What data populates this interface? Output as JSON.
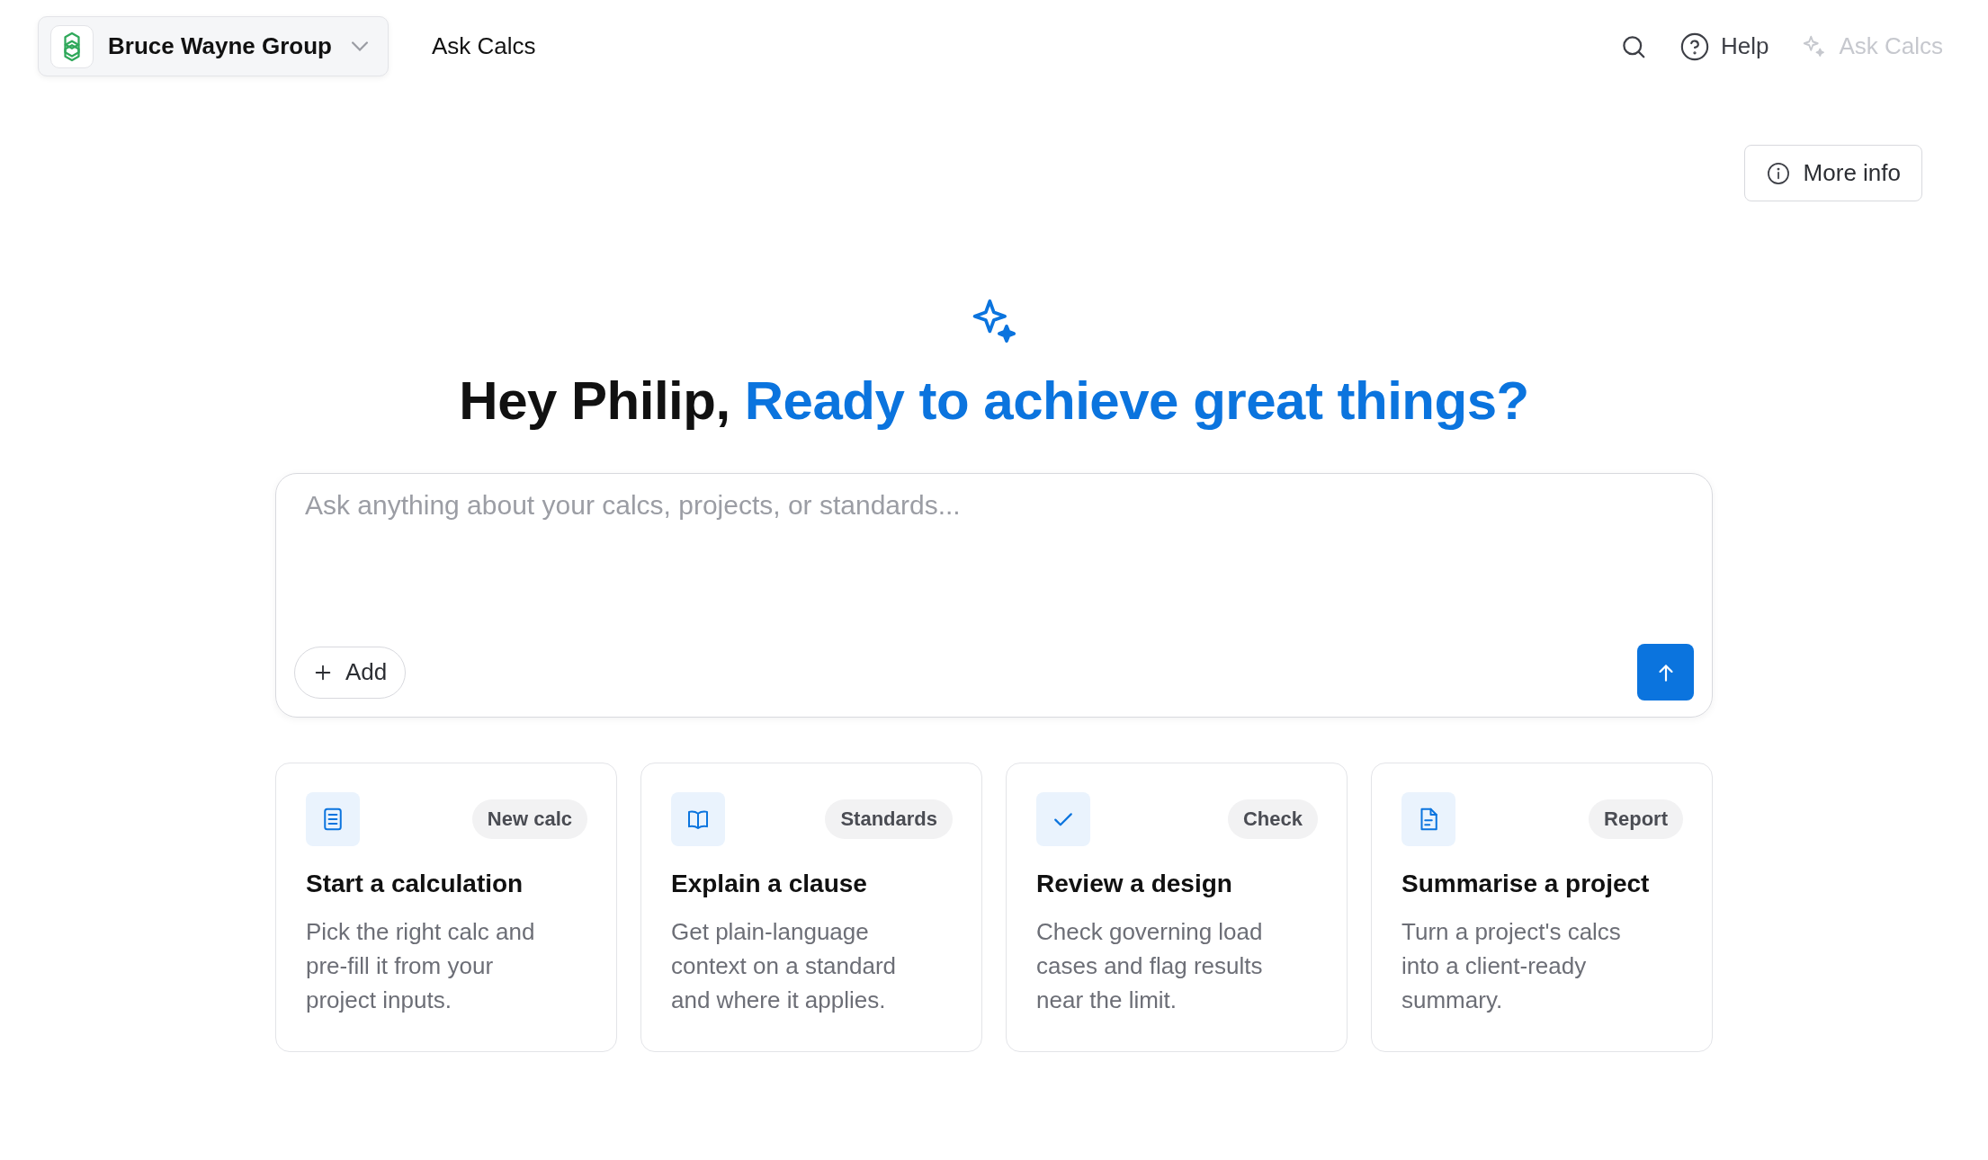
{
  "top_bar": {
    "workspace": {
      "name": "Bruce Wayne Group"
    },
    "nav": [
      {
        "label": "Ask Calcs"
      }
    ],
    "help": {
      "label": "Help"
    },
    "ask_button": {
      "label": "Ask Calcs",
      "disabled": true
    }
  },
  "more_info": {
    "label": "More info"
  },
  "heading": {
    "greeting": "Hey Philip,",
    "highlight": "Ready to achieve great things?"
  },
  "prompt": {
    "placeholder": "Ask anything about your calcs, projects, or standards...",
    "add_label": "Add"
  },
  "cards": [
    {
      "kind": "calc",
      "tag": "New calc",
      "title": "Start a calculation",
      "description": "Pick the right calc and pre-fill it from your project inputs."
    },
    {
      "kind": "book",
      "tag": "Standards",
      "title": "Explain a clause",
      "description": "Get plain-language context on a standard and where it applies."
    },
    {
      "kind": "check",
      "tag": "Check",
      "title": "Review a design",
      "description": "Check governing load cases and flag results near the limit."
    },
    {
      "kind": "report",
      "tag": "Report",
      "title": "Summarise a project",
      "description": "Turn a project's calcs into a client-ready summary."
    }
  ]
}
